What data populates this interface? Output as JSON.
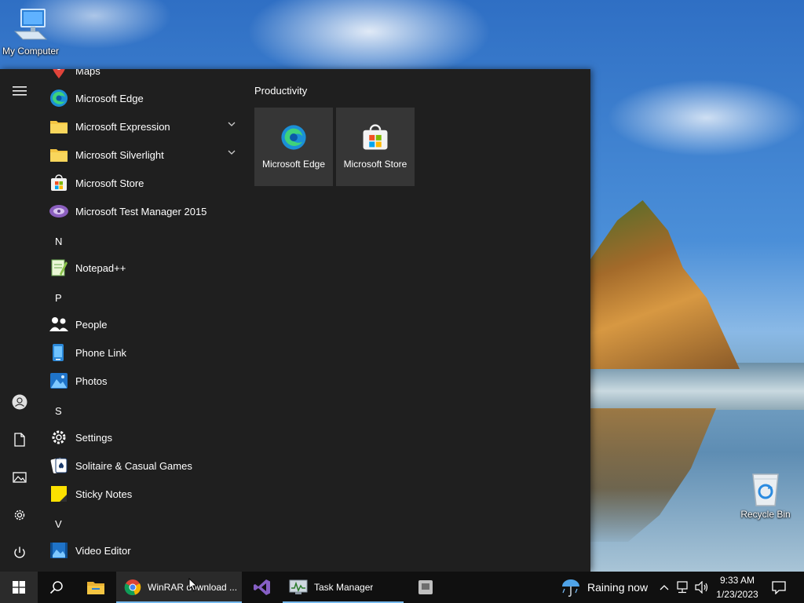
{
  "desktop": {
    "icons": [
      {
        "label": "My Computer"
      },
      {
        "label": "Recycle Bin"
      }
    ]
  },
  "start_menu": {
    "apps": [
      {
        "label": "Maps",
        "icon": "maps-icon"
      },
      {
        "label": "Microsoft Edge",
        "icon": "edge-icon"
      },
      {
        "label": "Microsoft Expression",
        "icon": "folder-icon",
        "expandable": true
      },
      {
        "label": "Microsoft Silverlight",
        "icon": "folder-icon",
        "expandable": true
      },
      {
        "label": "Microsoft Store",
        "icon": "store-icon"
      },
      {
        "label": "Microsoft Test Manager 2015",
        "icon": "test-manager-icon"
      }
    ],
    "letters": [
      "N",
      "P",
      "S",
      "V"
    ],
    "apps_n": [
      {
        "label": "Notepad++",
        "icon": "notepad-plus-plus-icon"
      }
    ],
    "apps_p": [
      {
        "label": "People",
        "icon": "people-icon"
      },
      {
        "label": "Phone Link",
        "icon": "phone-link-icon"
      },
      {
        "label": "Photos",
        "icon": "photos-icon"
      }
    ],
    "apps_s": [
      {
        "label": "Settings",
        "icon": "settings-gear-icon"
      },
      {
        "label": "Solitaire & Casual Games",
        "icon": "solitaire-icon"
      },
      {
        "label": "Sticky Notes",
        "icon": "sticky-notes-icon"
      }
    ],
    "apps_v": [
      {
        "label": "Video Editor",
        "icon": "video-editor-icon"
      }
    ],
    "tiles": {
      "heading": "Productivity",
      "items": [
        {
          "label": "Microsoft Edge",
          "icon": "edge-icon"
        },
        {
          "label": "Microsoft Store",
          "icon": "store-icon"
        }
      ]
    }
  },
  "taskbar": {
    "chrome_label": "WinRAR download ...",
    "task_manager_label": "Task Manager",
    "weather": "Raining now",
    "time": "9:33 AM",
    "date": "1/23/2023"
  },
  "colors": {
    "start_bg": "#1f1f1f",
    "tile_bg": "#363636",
    "taskbar_bg": "#101010",
    "accent": "#76b9ed"
  }
}
